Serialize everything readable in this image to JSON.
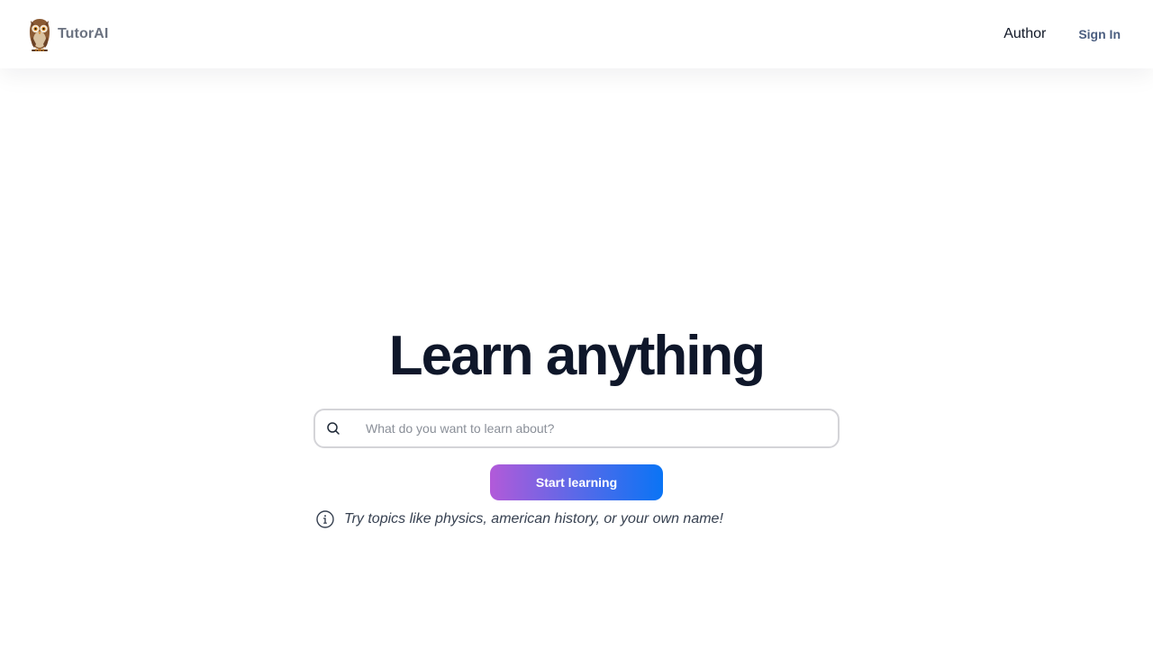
{
  "header": {
    "brand_name": "TutorAI",
    "nav_author": "Author",
    "nav_signin": "Sign In"
  },
  "hero": {
    "title": "Learn anything",
    "search_placeholder": "What do you want to learn about?",
    "search_value": "",
    "button_label": "Start learning",
    "hint_text": "Try topics like physics, american history, or your own name!"
  },
  "icons": {
    "logo": "owl-icon",
    "search": "search-icon",
    "info": "info-icon"
  },
  "colors": {
    "title": "#0f172a",
    "signin": "#4b5e80",
    "button_gradient_start": "#b25ad9",
    "button_gradient_end": "#0a74f5"
  }
}
